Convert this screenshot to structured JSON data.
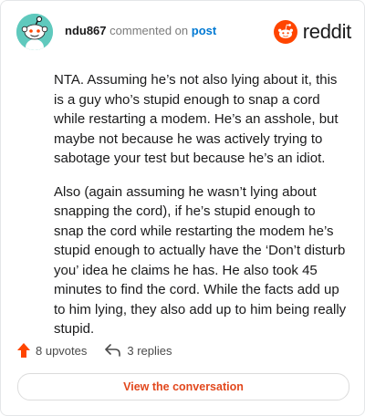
{
  "header": {
    "username": "ndu867",
    "action_text": "commented on",
    "link_text": "post",
    "brand_name": "reddit"
  },
  "comment": {
    "paragraphs": [
      "NTA. Assuming he’s not also lying about it, this is a guy who’s stupid enough to snap a cord while restarting a modem. He’s an asshole, but maybe not because he was actively trying to sabotage your test but because he’s an idiot.",
      "Also (again assuming he wasn’t lying about snapping the cord), if he’s stupid enough to snap the cord while restarting the modem he’s stupid enough to actually have the ‘Don’t disturb you’ idea he claims he has. He also took 45 minutes to find the cord. While the facts add up to him lying, they also add up to him being really stupid."
    ]
  },
  "footer": {
    "upvotes_label": "8 upvotes",
    "replies_label": "3 replies",
    "cta_label": "View the conversation"
  },
  "colors": {
    "avatar_bg": "#5fc9bd",
    "reddit_orange": "#ff4500",
    "link_blue": "#0079d3",
    "cta_text": "#e2481d"
  }
}
